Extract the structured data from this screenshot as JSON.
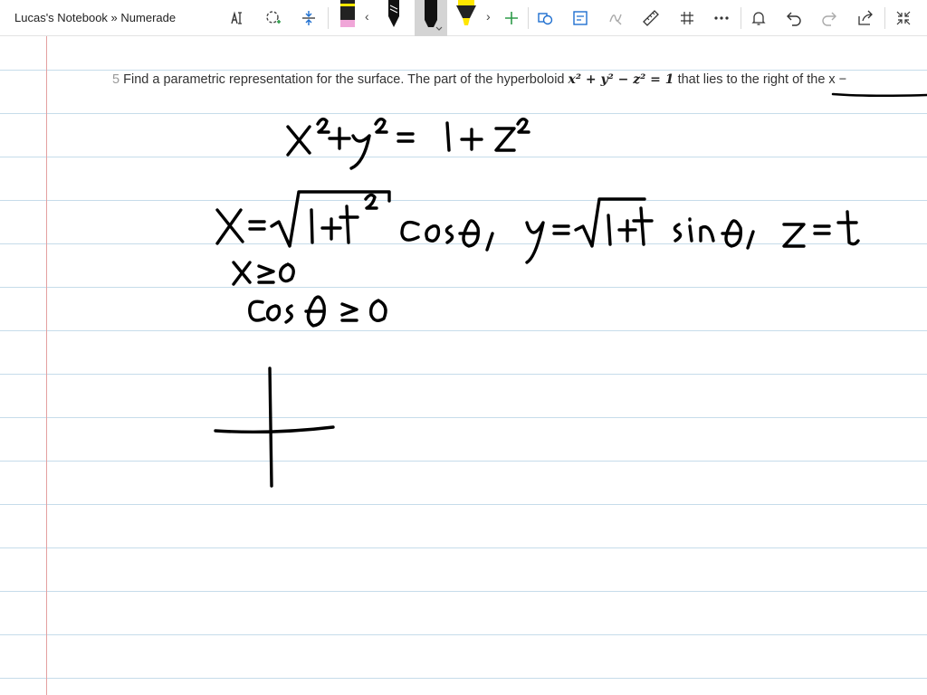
{
  "window": {
    "title": "Lucas's Notebook » Numerade"
  },
  "toolbar": {
    "icons": [
      "text-insert-icon",
      "lasso-select-icon",
      "insert-space-icon",
      "pink-pen-icon",
      "chevron-left-icon",
      "black-pen-icon",
      "black-marker-icon",
      "highlighter-icon",
      "chevron-right-icon",
      "add-pen-icon",
      "shapes-icon",
      "convert-ink-icon",
      "ink-to-math-icon",
      "ruler-icon",
      "snap-grid-icon",
      "more-icon",
      "notification-icon",
      "undo-icon",
      "redo-icon",
      "share-icon",
      "fullscreen-icon"
    ],
    "colors": {
      "pink_pen": "#f0a6d8",
      "highlighter": "#ffe600",
      "active_bg": "#d4d4d4"
    }
  },
  "question": {
    "marker": "5",
    "text_before": "Find a parametric representation for the surface. The part of the hyperboloid",
    "equation": "x² + y² − z² = 1",
    "text_after": "that lies to the",
    "tail": "right of the x −"
  },
  "handwriting": {
    "line1": "x² + y² = 1 + z²",
    "line2": "x = √(1+t²) cos θ ,  y = √(1+t²) sin θ ,  z = t",
    "line3": "x ≥ 0",
    "line4": "cos θ ≥ 0"
  },
  "colors": {
    "ink": "#000000",
    "rule_line": "#c6dcea",
    "margin_line": "#e4a0a0"
  }
}
